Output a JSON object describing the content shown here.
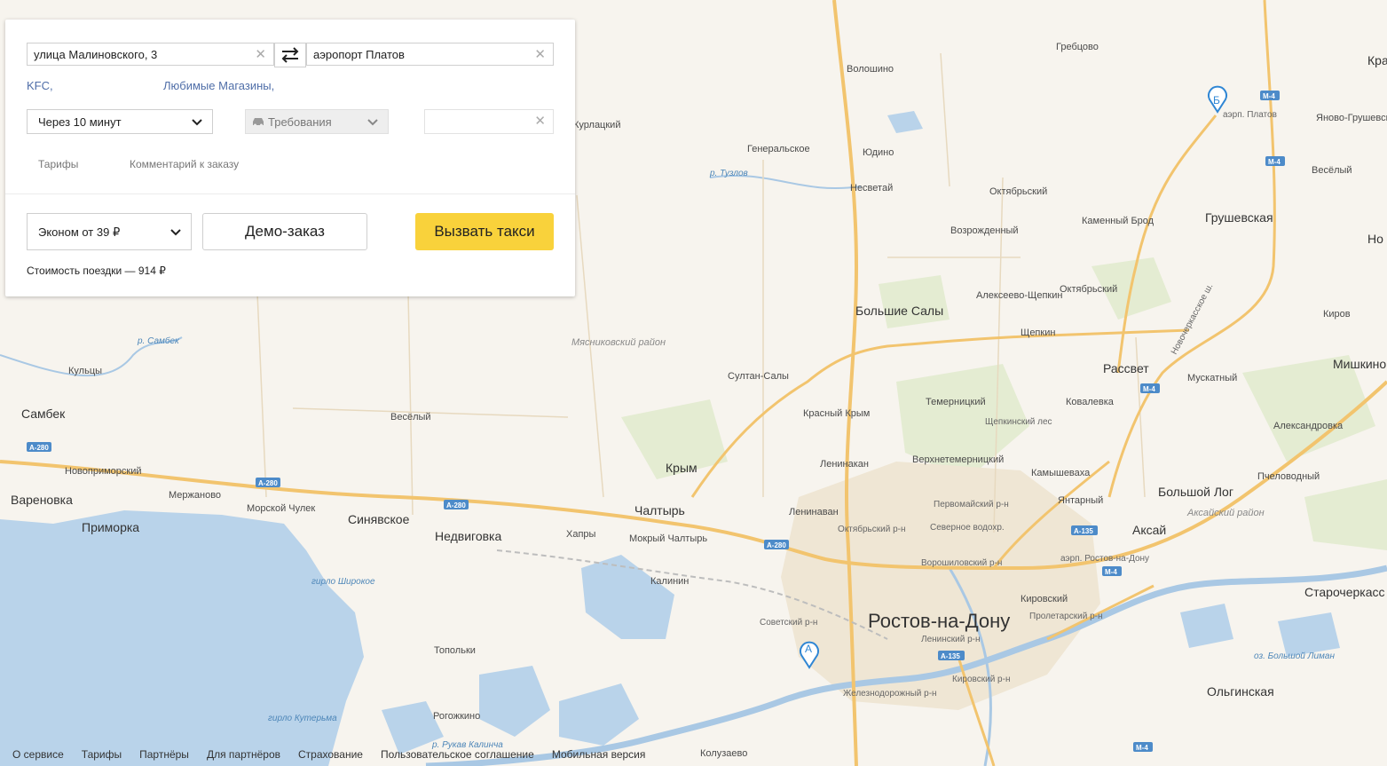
{
  "route": {
    "from": "улица Малиновского, 3",
    "to": "аэропорт Платов",
    "suggestions": [
      "KFC,",
      "Любимые Магазины,"
    ]
  },
  "options": {
    "time": "Через 10 минут",
    "requirements": "Требования",
    "extra_placeholder": ""
  },
  "tabs": {
    "tariffs": "Тарифы",
    "comment": "Комментарий к заказу"
  },
  "order": {
    "tariff": "Эконом от 39 ₽",
    "demo_button": "Демо-заказ",
    "call_button": "Вызвать такси",
    "price_text": "Стоимость поездки — 914 ₽"
  },
  "markers": {
    "a": "А",
    "b": "Б"
  },
  "map": {
    "cities": [
      "Ростов-на-Дону",
      "Аксай",
      "Чалтырь",
      "Крым",
      "Большие Салы",
      "Синявское",
      "Недвиговка",
      "Самбек",
      "Приморка",
      "Вареновка",
      "Рассвет",
      "Грушевская",
      "Мишкино",
      "Большой Лог",
      "Старочеркасс",
      "Ольгинская",
      "Нo",
      "Кра"
    ],
    "villages": [
      "Гребцово",
      "Волошино",
      "Генеральское",
      "Юдино",
      "Несветай",
      "Октябрьский",
      "Каменный Брод",
      "Возрожденный",
      "Алексеево-Щепкин",
      "Октябрьский",
      "Щепкин",
      "Кировский",
      "Кульцы",
      "Султан-Салы",
      "Красный Крым",
      "Темерницкий",
      "Ковалевка",
      "Мускатный",
      "Александровка",
      "Пчеловодный",
      "Весёлый",
      "Весёлый",
      "Яново-Грушевский",
      "Киров",
      "Курлацкий",
      "Новоприморский",
      "Мержаново",
      "Морской Чулек",
      "Хапры",
      "Мокрый Чалтырь",
      "Калинин",
      "Ленинакан",
      "Ленинаван",
      "Верхнетемерницкий",
      "Камышеваха",
      "Янтарный",
      "Топольки",
      "Рогожкино",
      "Колузаево"
    ],
    "districts": [
      "Первомайский р-н",
      "Октябрьский р-н",
      "Северное водохр.",
      "Ворошиловский р-н",
      "Советский р-н",
      "Ленинский р-н",
      "Пролетарский р-н",
      "Кировский р-н",
      "Железнодорожный р-н",
      "Щепкинский лес"
    ],
    "water": [
      "р. Самбек",
      "р. Тузлов",
      "гирло Широкое",
      "гирло Кутерьма",
      "р. Рукав Калинча",
      "оз. Большой Лиман"
    ],
    "regions": [
      "Мясниковский район",
      "Аксайский район"
    ],
    "airports": [
      "аэрп. Платов",
      "аэрп. Ростов-на-Дону"
    ],
    "roads": [
      "A-280",
      "A-280",
      "A-280",
      "A-280",
      "M-4",
      "M-4",
      "M-4",
      "M-4",
      "M-4",
      "A-135",
      "A-135"
    ],
    "road_names": [
      "Новочеркасское ш."
    ]
  },
  "footer": [
    "О сервисе",
    "Тарифы",
    "Партнёры",
    "Для партнёров",
    "Страхование",
    "Пользовательское соглашение",
    "Мобильная версия"
  ],
  "colors": {
    "call_button": "#f9d23b",
    "sea": "#b9d3ea",
    "road": "#f2c46e",
    "marker": "#2f86d4"
  }
}
